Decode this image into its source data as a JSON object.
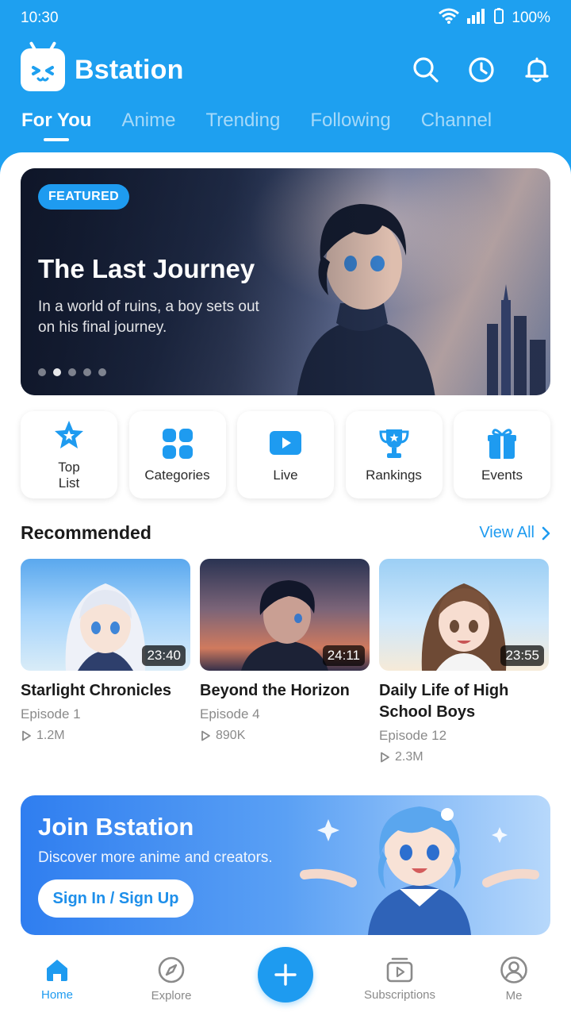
{
  "status": {
    "time": "10:30",
    "battery": "100%"
  },
  "header": {
    "app_name": "Bstation",
    "tabs": [
      {
        "label": "For You",
        "active": true
      },
      {
        "label": "Anime",
        "active": false
      },
      {
        "label": "Trending",
        "active": false
      },
      {
        "label": "Following",
        "active": false
      },
      {
        "label": "Channel",
        "active": false
      }
    ],
    "icons": [
      "search-icon",
      "history-clock-icon",
      "bell-icon"
    ]
  },
  "featured": {
    "badge": "FEATURED",
    "title": "The Last Journey",
    "subtitle": "In a world of ruins, a boy sets out on his final journey.",
    "slides": 5,
    "active_slide": 1
  },
  "quick_links": [
    {
      "label": "Top List",
      "icon": "star-badge-icon"
    },
    {
      "label": "Categories",
      "icon": "grid-icon"
    },
    {
      "label": "Live",
      "icon": "play-screen-icon"
    },
    {
      "label": "Rankings",
      "icon": "trophy-icon"
    },
    {
      "label": "Events",
      "icon": "gift-icon"
    }
  ],
  "recommended": {
    "title": "Recommended",
    "view_all": "View All",
    "items": [
      {
        "title": "Starlight Chronicles",
        "episode": "Episode 1",
        "views": "1.2M",
        "duration": "23:40"
      },
      {
        "title": "Beyond the Horizon",
        "episode": "Episode 4",
        "views": "890K",
        "duration": "24:11"
      },
      {
        "title": "Daily Life of High School Boys",
        "episode": "Episode 12",
        "views": "2.3M",
        "duration": "23:55"
      }
    ]
  },
  "join": {
    "title": "Join Bstation",
    "subtitle": "Discover more anime and creators.",
    "button": "Sign In / Sign Up"
  },
  "nav": {
    "home": "Home",
    "explore": "Explore",
    "subscriptions": "Subscriptions",
    "me": "Me"
  },
  "colors": {
    "primary": "#1ea0f0",
    "accent_text": "#1e9bf0"
  }
}
